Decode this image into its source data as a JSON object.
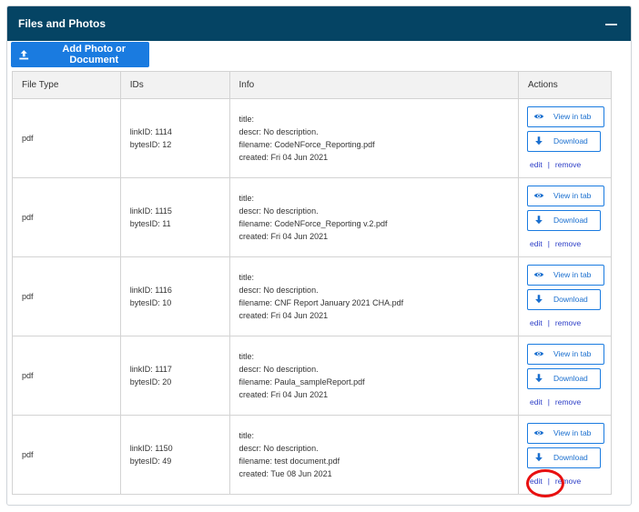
{
  "panel": {
    "title": "Files and Photos"
  },
  "toolbar": {
    "add_label": "Add Photo or Document"
  },
  "table": {
    "headers": [
      "File Type",
      "IDs",
      "Info",
      "Actions"
    ],
    "rows": [
      {
        "type": "pdf",
        "link_id": "linkID: 1114",
        "bytes_id": "bytesID: 12",
        "title": "title:",
        "descr": "descr: No description.",
        "filename": "filename: CodeNForce_Reporting.pdf",
        "created": "created: Fri 04 Jun 2021"
      },
      {
        "type": "pdf",
        "link_id": "linkID: 1115",
        "bytes_id": "bytesID: 11",
        "title": "title:",
        "descr": "descr: No description.",
        "filename": "filename: CodeNForce_Reporting v.2.pdf",
        "created": "created: Fri 04 Jun 2021"
      },
      {
        "type": "pdf",
        "link_id": "linkID: 1116",
        "bytes_id": "bytesID: 10",
        "title": "title:",
        "descr": "descr: No description.",
        "filename": "filename: CNF Report January 2021 CHA.pdf",
        "created": "created: Fri 04 Jun 2021"
      },
      {
        "type": "pdf",
        "link_id": "linkID: 1117",
        "bytes_id": "bytesID: 20",
        "title": "title:",
        "descr": "descr: No description.",
        "filename": "filename: Paula_sampleReport.pdf",
        "created": "created: Fri 04 Jun 2021"
      },
      {
        "type": "pdf",
        "link_id": "linkID: 1150",
        "bytes_id": "bytesID: 49",
        "title": "title:",
        "descr": "descr: No description.",
        "filename": "filename: test document.pdf",
        "created": "created: Tue 08 Jun 2021"
      }
    ]
  },
  "actions": {
    "view_label": "View in tab",
    "download_label": "Download",
    "edit_label": "edit",
    "separator": "|",
    "remove_label": "remove"
  },
  "icons": {
    "view": "eye-icon",
    "download": "arrow-down-icon",
    "upload": "upload-icon",
    "collapse": "minus-icon"
  },
  "colors": {
    "header_bg": "#054464",
    "primary": "#1a7be0",
    "highlight": "#e81010"
  }
}
